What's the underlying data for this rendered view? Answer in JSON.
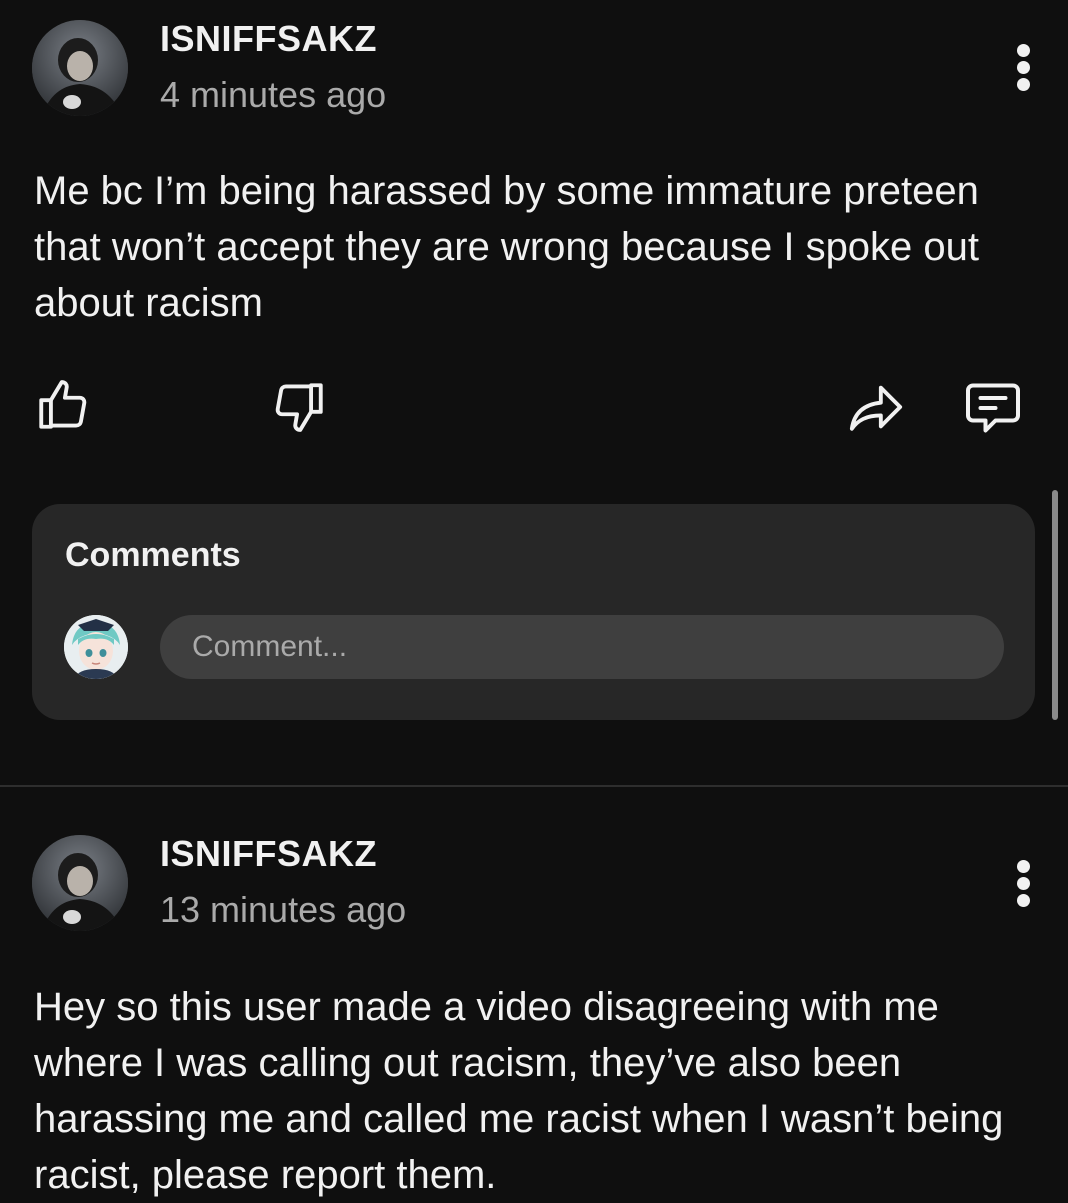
{
  "posts": [
    {
      "author": "ISNIFFSAKZ",
      "time": "4 minutes ago",
      "text": "Me bc I’m being harassed by some immature preteen that won’t accept they are wrong because I spoke out about racism"
    },
    {
      "author": "ISNIFFSAKZ",
      "time": "13 minutes ago",
      "text": "Hey so this user made a video disagreeing with me where I was calling out racism, they’ve also been harassing me and called me racist when I wasn’t being racist, please report them."
    }
  ],
  "comments": {
    "title": "Comments",
    "placeholder": "Comment..."
  },
  "icons": {
    "like": "thumbs-up-icon",
    "dislike": "thumbs-down-icon",
    "share": "share-icon",
    "comment": "comment-icon",
    "menu": "more-vert-icon"
  },
  "colors": {
    "background": "#0f0f0f",
    "card": "#272727",
    "input": "#3f3f3f",
    "secondary_text": "#aaaaaa"
  }
}
